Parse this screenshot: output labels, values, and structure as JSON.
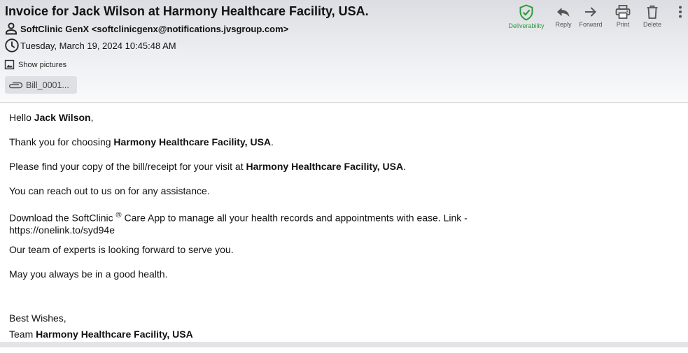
{
  "header": {
    "subject": "Invoice for Jack Wilson at Harmony Healthcare Facility, USA.",
    "from": "SoftClinic GenX <softclinicgenx@notifications.jvsgroup.com>",
    "date": "Tuesday, March 19, 2024 10:45:48 AM",
    "show_pictures": "Show pictures",
    "attachment": "Bill_0001..."
  },
  "toolbar": {
    "deliverability": "Deliverability",
    "reply": "Reply",
    "forward": "Forward",
    "print": "Print",
    "delete": "Delete",
    "deliverability_color": "#2e9b3e"
  },
  "message": {
    "greeting_prefix": "Hello ",
    "recipient": "Jack Wilson",
    "greeting_suffix": ",",
    "thanks_prefix": "Thank you for choosing ",
    "facility": "Harmony Healthcare Facility, USA",
    "period": ".",
    "bill_prefix": "Please find your copy of the bill/receipt for your visit at ",
    "reach_out": "You can reach out to us on for any assistance.",
    "download_prefix": "Download the SoftClinic ",
    "registered": "®",
    "download_suffix": " Care App to manage all your health records and appointments with ease. Link -",
    "link": "https://onelink.to/syd94e",
    "team_line": "Our team of experts is looking forward to serve you.",
    "health_line": "May you always be in a good health.",
    "best_wishes": "Best Wishes,",
    "team_prefix": "Team "
  }
}
